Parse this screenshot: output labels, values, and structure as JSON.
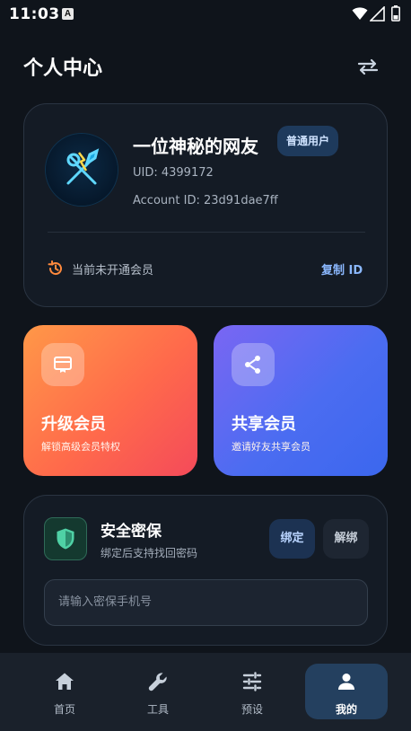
{
  "status_bar": {
    "time": "11:03",
    "app_icon_letter": "A"
  },
  "header": {
    "title": "个人中心",
    "switch_icon": "swap-arrows-icon"
  },
  "profile": {
    "nickname": "一位神秘的网友",
    "badge": "普通用户",
    "uid": "UID: 4399172",
    "account_id": "Account ID: 23d91dae7ff",
    "member_status": "当前未开通会员",
    "copy_id_label": "复制 ID",
    "avatar_icon": "tools-icon"
  },
  "promos": {
    "upgrade": {
      "title": "升级会员",
      "subtitle": "解锁高级会员特权",
      "icon": "vip-card-icon"
    },
    "share": {
      "title": "共享会员",
      "subtitle": "邀请好友共享会员",
      "icon": "share-icon"
    }
  },
  "security": {
    "title": "安全密保",
    "subtitle": "绑定后支持找回密码",
    "bind_label": "绑定",
    "unbind_label": "解绑",
    "input_placeholder": "请输入密保手机号",
    "icon": "shield-icon"
  },
  "nav": {
    "items": [
      {
        "label": "首页",
        "icon": "home-icon"
      },
      {
        "label": "工具",
        "icon": "wrench-icon"
      },
      {
        "label": "预设",
        "icon": "sliders-icon"
      },
      {
        "label": "我的",
        "icon": "person-icon"
      }
    ],
    "active_index": 3
  },
  "colors": {
    "background": "#0f141b",
    "card": "#141b25",
    "accent_blue": "#8bb8ff",
    "history_orange": "#ff8a3d",
    "shield_green": "#4fd1a5"
  }
}
